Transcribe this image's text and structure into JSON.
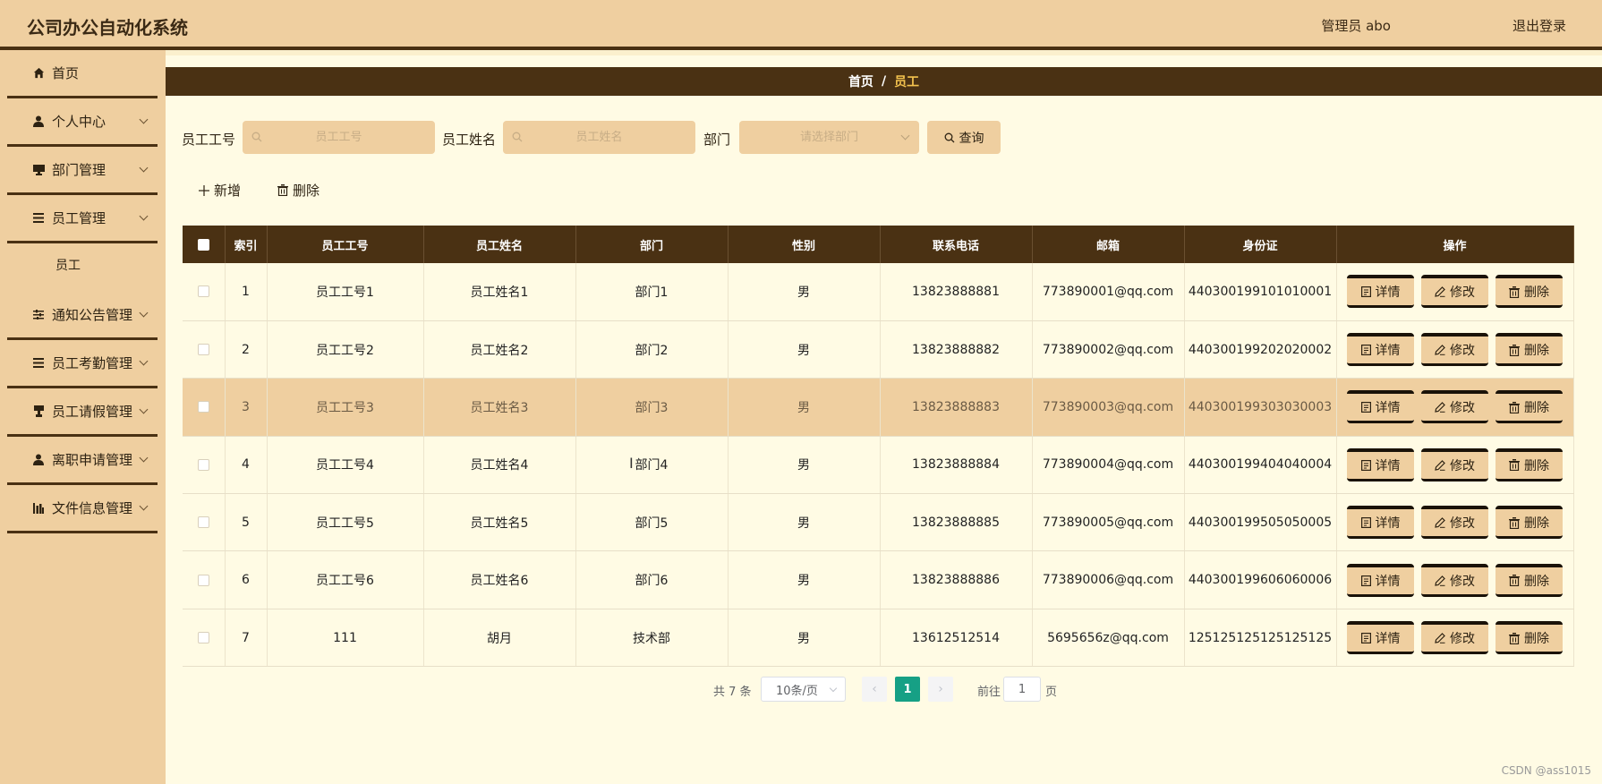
{
  "header": {
    "title": "公司办公自动化系统",
    "user": "管理员 abo",
    "logout": "退出登录"
  },
  "sidebar": {
    "items": [
      {
        "label": "首页",
        "icon": "home-icon"
      },
      {
        "label": "个人中心",
        "icon": "user-icon"
      },
      {
        "label": "部门管理",
        "icon": "monitor-icon"
      },
      {
        "label": "员工管理",
        "icon": "list-icon"
      },
      {
        "label": "通知公告管理",
        "icon": "sliders-icon"
      },
      {
        "label": "员工考勤管理",
        "icon": "list-icon"
      },
      {
        "label": "员工请假管理",
        "icon": "cup-icon"
      },
      {
        "label": "离职申请管理",
        "icon": "user-icon"
      },
      {
        "label": "文件信息管理",
        "icon": "chart-icon"
      }
    ],
    "sub_item": "员工"
  },
  "breadcrumb": {
    "home": "首页",
    "separator": "/",
    "current": "员工"
  },
  "search": {
    "id_label": "员工工号",
    "id_placeholder": "员工工号",
    "name_label": "员工姓名",
    "name_placeholder": "员工姓名",
    "dept_label": "部门",
    "dept_placeholder": "请选择部门",
    "query_button": "查询"
  },
  "actions": {
    "add": "新增",
    "delete": "删除"
  },
  "table": {
    "columns": [
      "索引",
      "员工工号",
      "员工姓名",
      "部门",
      "性别",
      "联系电话",
      "邮箱",
      "身份证",
      "操作"
    ],
    "rows": [
      {
        "index": "1",
        "id": "员工工号1",
        "name": "员工姓名1",
        "dept": "部门1",
        "gender": "男",
        "phone": "13823888881",
        "email": "773890001@qq.com",
        "idcard": "440300199101010001"
      },
      {
        "index": "2",
        "id": "员工工号2",
        "name": "员工姓名2",
        "dept": "部门2",
        "gender": "男",
        "phone": "13823888882",
        "email": "773890002@qq.com",
        "idcard": "440300199202020002"
      },
      {
        "index": "3",
        "id": "员工工号3",
        "name": "员工姓名3",
        "dept": "部门3",
        "gender": "男",
        "phone": "13823888883",
        "email": "773890003@qq.com",
        "idcard": "440300199303030003"
      },
      {
        "index": "4",
        "id": "员工工号4",
        "name": "员工姓名4",
        "dept": "部门4",
        "gender": "男",
        "phone": "13823888884",
        "email": "773890004@qq.com",
        "idcard": "440300199404040004"
      },
      {
        "index": "5",
        "id": "员工工号5",
        "name": "员工姓名5",
        "dept": "部门5",
        "gender": "男",
        "phone": "13823888885",
        "email": "773890005@qq.com",
        "idcard": "440300199505050005"
      },
      {
        "index": "6",
        "id": "员工工号6",
        "name": "员工姓名6",
        "dept": "部门6",
        "gender": "男",
        "phone": "13823888886",
        "email": "773890006@qq.com",
        "idcard": "440300199606060006"
      },
      {
        "index": "7",
        "id": "111",
        "name": "胡月",
        "dept": "技术部",
        "gender": "男",
        "phone": "13612512514",
        "email": "5695656z@qq.com",
        "idcard": "125125125125125125"
      }
    ],
    "row_buttons": {
      "detail": "详情",
      "edit": "修改",
      "delete": "删除"
    }
  },
  "pagination": {
    "total": "共 7 条",
    "page_size": "10条/页",
    "current_page": "1",
    "goto_label": "前往",
    "goto_value": "1",
    "page_unit": "页"
  },
  "watermark": "CSDN @ass1015",
  "colors": {
    "accent": "#efcfa0",
    "dark": "#4a3113",
    "background": "#fffbe4",
    "pager_active": "#16a085"
  }
}
